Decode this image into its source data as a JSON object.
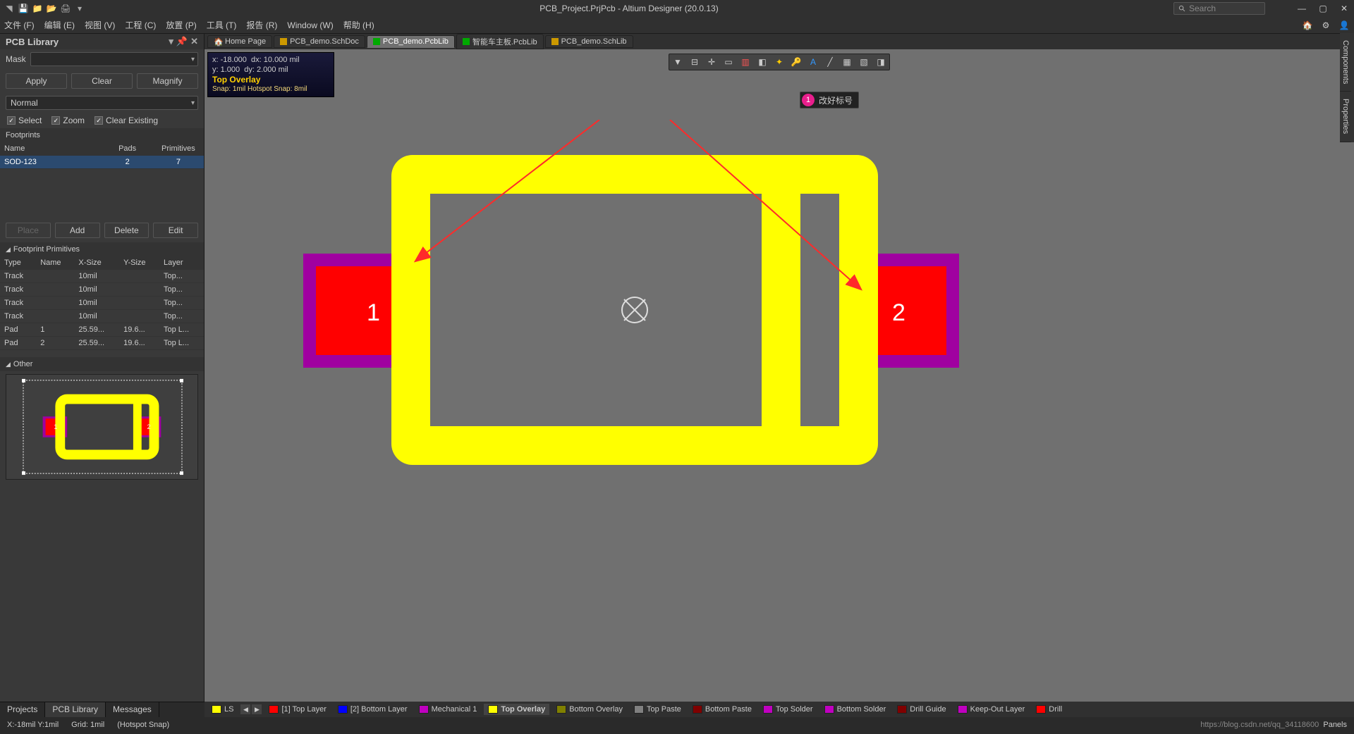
{
  "title": "PCB_Project.PrjPcb - Altium Designer (20.0.13)",
  "search_placeholder": "Search",
  "menu": {
    "file": "文件 (F)",
    "edit": "编辑 (E)",
    "view": "视图 (V)",
    "project": "工程 (C)",
    "place": "放置 (P)",
    "tools": "工具 (T)",
    "report": "报告 (R)",
    "window": "Window (W)",
    "help": "帮助 (H)"
  },
  "panel": {
    "title": "PCB Library",
    "mask_label": "Mask",
    "apply": "Apply",
    "clear": "Clear",
    "magnify": "Magnify",
    "normal": "Normal",
    "select": "Select",
    "zoom": "Zoom",
    "clear_existing": "Clear Existing",
    "footprints": "Footprints",
    "fp_cols": {
      "name": "Name",
      "pads": "Pads",
      "primitives": "Primitives"
    },
    "fp_rows": [
      {
        "name": "SOD-123",
        "pads": "2",
        "primitives": "7"
      }
    ],
    "place": "Place",
    "add": "Add",
    "delete": "Delete",
    "edit": "Edit",
    "prim_header": "Footprint Primitives",
    "prim_cols": {
      "type": "Type",
      "name": "Name",
      "xsize": "X-Size",
      "ysize": "Y-Size",
      "layer": "Layer"
    },
    "prim_rows": [
      {
        "type": "Track",
        "name": "",
        "xsize": "10mil",
        "ysize": "",
        "layer": "Top..."
      },
      {
        "type": "Track",
        "name": "",
        "xsize": "10mil",
        "ysize": "",
        "layer": "Top..."
      },
      {
        "type": "Track",
        "name": "",
        "xsize": "10mil",
        "ysize": "",
        "layer": "Top..."
      },
      {
        "type": "Track",
        "name": "",
        "xsize": "10mil",
        "ysize": "",
        "layer": "Top..."
      },
      {
        "type": "Pad",
        "name": "1",
        "xsize": "25.59...",
        "ysize": "19.6...",
        "layer": "Top L..."
      },
      {
        "type": "Pad",
        "name": "2",
        "xsize": "25.59...",
        "ysize": "19.6...",
        "layer": "Top L..."
      }
    ],
    "other": "Other"
  },
  "ptabs": {
    "projects": "Projects",
    "pcb_library": "PCB Library",
    "messages": "Messages"
  },
  "doc_tabs": [
    {
      "label": "Home Page"
    },
    {
      "label": "PCB_demo.SchDoc"
    },
    {
      "label": "PCB_demo.PcbLib",
      "active": true
    },
    {
      "label": "智能车主板.PcbLib"
    },
    {
      "label": "PCB_demo.SchLib"
    }
  ],
  "hud": {
    "x": "x:    -18.000",
    "dx": "dx:    10.000  mil",
    "y": "y:      1.000",
    "dy": "dy:     2.000  mil",
    "layer": "Top Overlay",
    "snap": "Snap: 1mil Hotspot Snap: 8mil"
  },
  "annotation": {
    "num": "1",
    "text": "改好标号"
  },
  "pads": {
    "p1": "1",
    "p2": "2"
  },
  "side_tabs": {
    "components": "Components",
    "properties": "Properties"
  },
  "layers": {
    "ls": "LS",
    "items": [
      {
        "name": "[1] Top Layer",
        "color": "#FF0000"
      },
      {
        "name": "[2] Bottom Layer",
        "color": "#0000FF"
      },
      {
        "name": "Mechanical 1",
        "color": "#C000C0"
      },
      {
        "name": "Top Overlay",
        "color": "#FFFF00",
        "active": true
      },
      {
        "name": "Bottom Overlay",
        "color": "#808000"
      },
      {
        "name": "Top Paste",
        "color": "#808080"
      },
      {
        "name": "Bottom Paste",
        "color": "#800000"
      },
      {
        "name": "Top Solder",
        "color": "#C000C0"
      },
      {
        "name": "Bottom Solder",
        "color": "#C000C0"
      },
      {
        "name": "Drill Guide",
        "color": "#800000"
      },
      {
        "name": "Keep-Out Layer",
        "color": "#C000C0"
      },
      {
        "name": "Drill",
        "color": "#FF0000"
      }
    ]
  },
  "status": {
    "coord": "X:-18mil Y:1mil",
    "grid": "Grid: 1mil",
    "hotspot": "(Hotspot Snap)",
    "url": "https://blog.csdn.net/qq_34118600",
    "panels": "Panels"
  }
}
